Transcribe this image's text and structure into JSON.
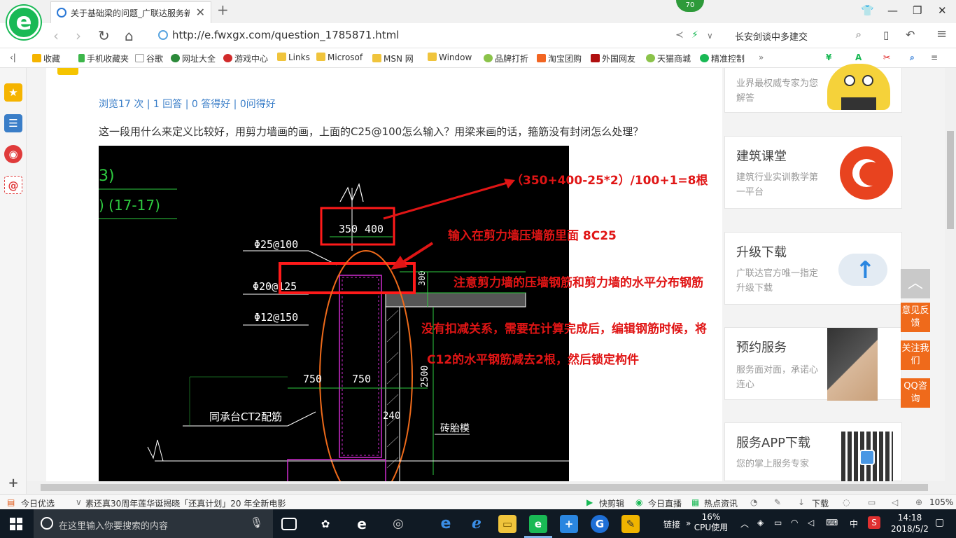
{
  "browser": {
    "logo_letter": "e",
    "tab_title": "关于基础梁的问题_广联达服务新",
    "tab_close": "✕",
    "new_tab": "+",
    "badge": "70",
    "url": "http://e.fwxgx.com/question_1785871.html",
    "search_text": "长安剑谈中多建交"
  },
  "bookmarks": [
    {
      "label": "收藏",
      "icon": "star-icon"
    },
    {
      "label": "手机收藏夹",
      "icon": "phone-icon"
    },
    {
      "label": "谷歌",
      "icon": "page-icon"
    },
    {
      "label": "网址大全",
      "icon": "web-icon"
    },
    {
      "label": "游戏中心",
      "icon": "game-icon"
    },
    {
      "label": "Links",
      "icon": "folder-icon"
    },
    {
      "label": "Microsof",
      "icon": "folder-icon"
    },
    {
      "label": "MSN 网",
      "icon": "folder-icon"
    },
    {
      "label": "Window",
      "icon": "folder-icon"
    },
    {
      "label": "品牌打折",
      "icon": "leaf-icon"
    },
    {
      "label": "淘宝团购",
      "icon": "taobao-icon"
    },
    {
      "label": "外国网友",
      "icon": "flag-icon"
    },
    {
      "label": "天猫商城",
      "icon": "leaf-icon"
    },
    {
      "label": "精准控制",
      "icon": "chat-icon"
    }
  ],
  "page": {
    "stats": "浏览17 次 | 1 回答 | 0 答得好 | 0问得好",
    "question": "这一段用什么来定义比较好，用剪力墙画的画，上面的C25@100怎么输入？用梁来画的话，箍筋没有封闭怎么处理？"
  },
  "cad": {
    "label_a": "3)",
    "label_b": ")  (17-17)",
    "dim_350": "350",
    "dim_400": "400",
    "rebar_1": "Φ25@100",
    "rebar_2": "Φ20@125",
    "rebar_3": "Φ12@150",
    "dim_300": "300",
    "dim_750a": "750",
    "dim_750b": "750",
    "dim_2500": "2500",
    "dim_240": "240",
    "note_ct2": "同承台CT2配筋",
    "note_brick": "砖胎模"
  },
  "annotations": {
    "formula": "（350+400-25*2）/100+1=8根",
    "input_note": "输入在剪力墙压墙筋里面 8C25",
    "attention": "注意剪力墙的压墙钢筋和剪力墙的水平分布钢筋",
    "no_deduct": "没有扣减关系，需要在计算完成后，编辑钢筋时候，将",
    "c12_note": "C12的水平钢筋减去2根，然后锁定构件"
  },
  "sidebar_cards": [
    {
      "title": "",
      "sub": "业界最权威专家为您解答"
    },
    {
      "title": "建筑课堂",
      "sub": "建筑行业实训教学第一平台"
    },
    {
      "title": "升级下载",
      "sub": "广联达官方唯一指定升级下载"
    },
    {
      "title": "预约服务",
      "sub": "服务面对面，承诺心连心"
    },
    {
      "title": "服务APP下载",
      "sub": "您的掌上服务专家"
    }
  ],
  "float_buttons": [
    {
      "label": "意见反馈"
    },
    {
      "label": "关注我们"
    },
    {
      "label": "QQ咨询"
    }
  ],
  "status_bar": {
    "today": "今日优选",
    "news": "素还真30周年莲华诞揭晓「还真计划」20 年全新电影",
    "kuaijian": "快剪辑",
    "live": "今日直播",
    "hot": "热点资讯",
    "download": "下载",
    "zoom": "105%"
  },
  "taskbar": {
    "search_placeholder": "在这里输入你要搜索的内容",
    "link_label": "链接",
    "cpu_pct": "16%",
    "cpu_label": "CPU使用",
    "ime": "中",
    "time": "14:18",
    "date": "2018/5/2"
  },
  "colors": {
    "accent_green": "#19b955",
    "annotation_red": "#e01515",
    "float_orange": "#ef6a1b"
  }
}
